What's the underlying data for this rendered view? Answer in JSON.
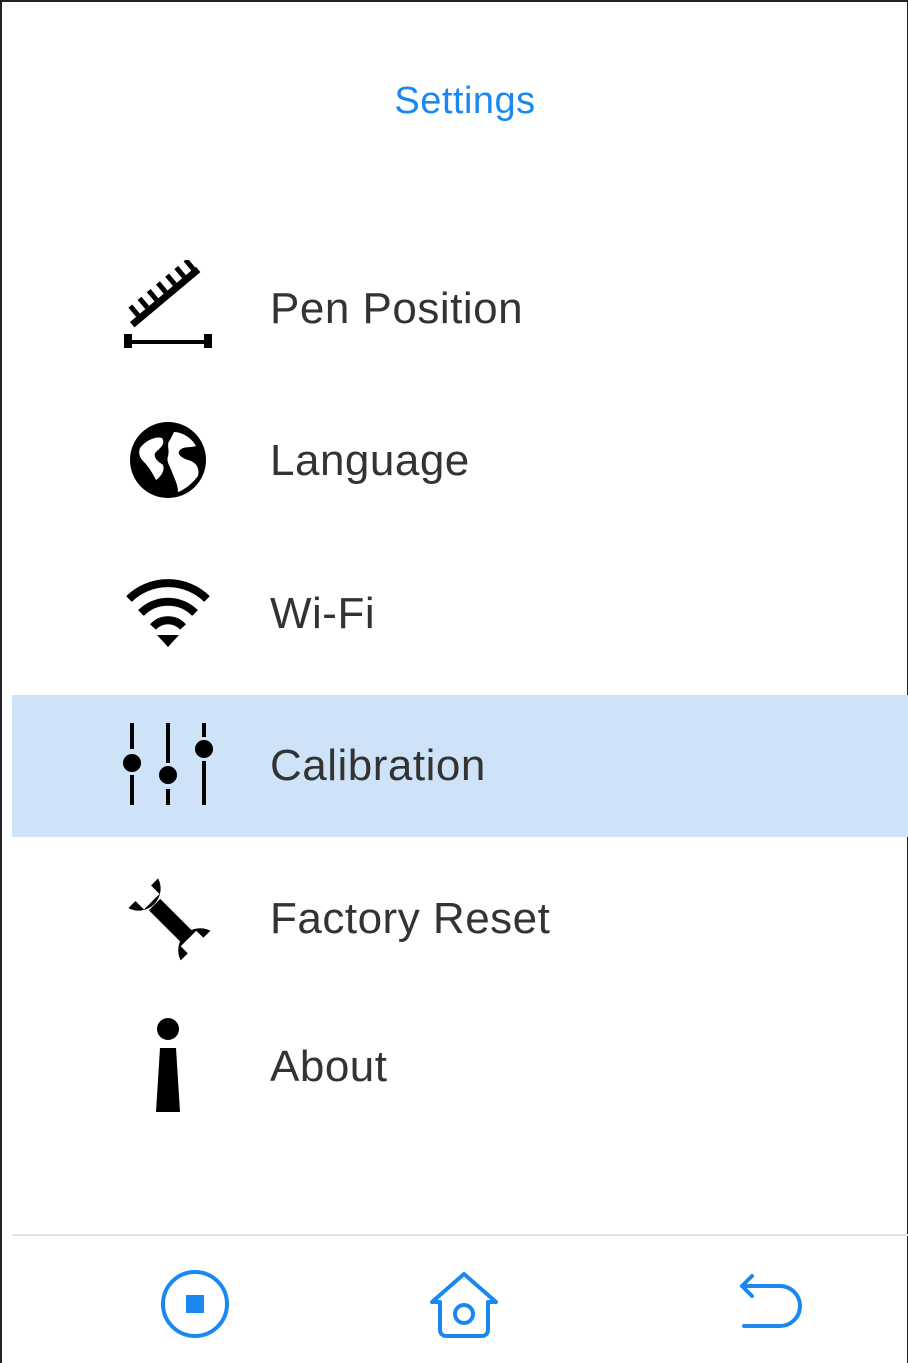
{
  "header": {
    "title": "Settings"
  },
  "menu": {
    "items": [
      {
        "label": "Pen Position",
        "icon": "ruler-icon"
      },
      {
        "label": "Language",
        "icon": "globe-icon"
      },
      {
        "label": "Wi-Fi",
        "icon": "wifi-icon"
      },
      {
        "label": "Calibration",
        "icon": "sliders-icon",
        "selected": true
      },
      {
        "label": "Factory Reset",
        "icon": "wrench-icon"
      },
      {
        "label": "About",
        "icon": "info-icon"
      }
    ]
  },
  "bottom_bar": {
    "buttons": [
      {
        "icon": "stop-icon"
      },
      {
        "icon": "home-icon"
      },
      {
        "icon": "back-icon"
      }
    ]
  },
  "colors": {
    "accent": "#1a88f0",
    "selected_background": "#cfe3f8",
    "text": "#333333"
  }
}
